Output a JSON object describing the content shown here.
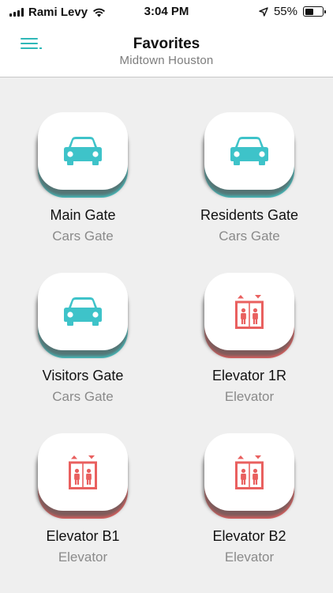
{
  "status_bar": {
    "carrier": "Rami Levy",
    "time": "3:04 PM",
    "battery_percent": "55%",
    "battery_level": 0.55,
    "icons": [
      "signal-icon",
      "wifi-icon",
      "location-arrow-icon",
      "battery-icon"
    ]
  },
  "nav": {
    "title": "Favorites",
    "subtitle": "Midtown Houston",
    "menu_icon": "hamburger-menu-icon"
  },
  "colors": {
    "teal": "#43c7c7",
    "red": "#e9605f",
    "car_icon": "#3ec3c9",
    "elevator_icon": "#e9605f"
  },
  "favorites": [
    {
      "name": "Main Gate",
      "type": "Cars Gate",
      "icon": "car-icon"
    },
    {
      "name": "Residents Gate",
      "type": "Cars Gate",
      "icon": "car-icon"
    },
    {
      "name": "Visitors Gate",
      "type": "Cars Gate",
      "icon": "car-icon"
    },
    {
      "name": "Elevator 1R",
      "type": "Elevator",
      "icon": "elevator-icon"
    },
    {
      "name": "Elevator B1",
      "type": "Elevator",
      "icon": "elevator-icon"
    },
    {
      "name": "Elevator B2",
      "type": "Elevator",
      "icon": "elevator-icon"
    }
  ]
}
